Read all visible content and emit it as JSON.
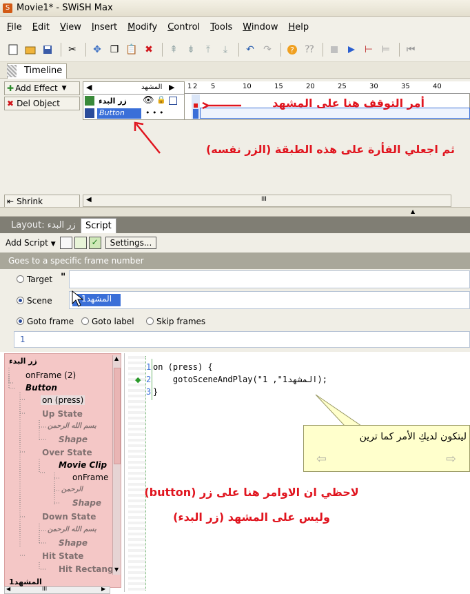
{
  "window": {
    "title": "Movie1* - SWiSH Max"
  },
  "menu": [
    "File",
    "Edit",
    "View",
    "Insert",
    "Modify",
    "Control",
    "Tools",
    "Window",
    "Help"
  ],
  "timeline": {
    "tab": "Timeline",
    "add_effect": "Add Effect",
    "del_object": "Del Object",
    "shrink": "Shrink",
    "scene_label": "المشهد",
    "ruler": [
      "1",
      "2",
      "5",
      "10",
      "15",
      "20",
      "25",
      "30",
      "35",
      "40"
    ],
    "layers": [
      {
        "name": "زر البدء"
      },
      {
        "name": "Button",
        "dots": "• • •"
      }
    ],
    "scroll_mark": "III"
  },
  "notes": {
    "stop_here": "أمر التوقف هنا على المشهد",
    "mouse_layer": "ثم اجعلي الفأرة على هذه الطبقة (الزر نفسه)",
    "on_button": "لاحظي ان الاوامر هنا على زر (button)",
    "not_scene": "وليس على المشهد (زر البدء)"
  },
  "panel_tabs": {
    "layout": "Layout: زر البدء",
    "script": "Script"
  },
  "script_toolbar": {
    "add_script": "Add Script",
    "settings": "Settings..."
  },
  "hint": "Goes to a specific frame number",
  "params": {
    "target_label": "Target",
    "target_quote": "\"",
    "scene_label": "Scene",
    "scene_value": "المشهد1",
    "goto_frame": "Goto frame",
    "goto_label": "Goto label",
    "skip_frames": "Skip frames",
    "frame_value": "1"
  },
  "tree": [
    {
      "text": "زر البدء",
      "bold": true
    },
    {
      "text": "onFrame (2)"
    },
    {
      "text": "Button",
      "bold": true,
      "italic": true
    },
    {
      "text": "on (press)"
    },
    {
      "text": "Up State"
    },
    {
      "text": "بسم الله الرحمن"
    },
    {
      "text": "Shape"
    },
    {
      "text": "Over State"
    },
    {
      "text": "Movie Clip"
    },
    {
      "text": "onFrame"
    },
    {
      "text": "الرحمن"
    },
    {
      "text": "Shape"
    },
    {
      "text": "Down State"
    },
    {
      "text": "بسم الله الرحمن"
    },
    {
      "text": "Shape"
    },
    {
      "text": "Hit State"
    },
    {
      "text": "Hit Rectang"
    },
    {
      "text": "المشهد1"
    }
  ],
  "tree_scroll": "III",
  "code": {
    "lines": [
      "on (press) {",
      "    gotoSceneAndPlay(\"المشهد1\", 1);",
      "}"
    ],
    "line_numbers": [
      "1",
      "2",
      "3"
    ]
  },
  "bubble": {
    "text": "ليتكون لديكِ الأمر كما ترين"
  },
  "colors": {
    "annotation": "#e0141e",
    "tree_highlight": "#f4c7c6",
    "scene_field": "#3a6fd8"
  }
}
